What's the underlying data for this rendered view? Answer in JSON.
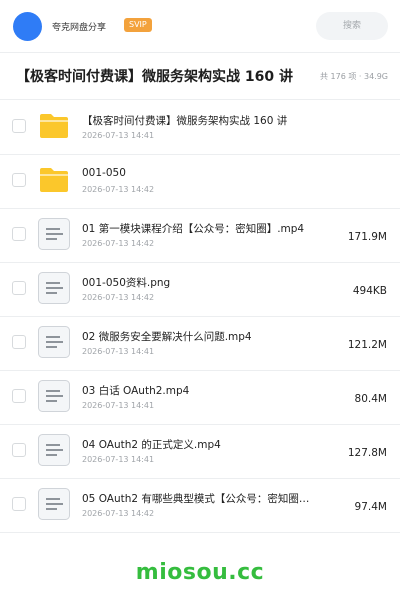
{
  "header": {
    "username": "夸克网盘分享",
    "badge": "SVIP",
    "search_label": "搜索",
    "avatar_color": "#2f7cf6"
  },
  "share": {
    "title": "【极客时间付费课】微服务架构实战 160 讲",
    "meta": "共 176 项 · 34.9G"
  },
  "files": [
    {
      "type": "folder",
      "icon": "folder-icon",
      "name": "【极客时间付费课】微服务架构实战 160 讲",
      "date": "2026-07-13 14:41",
      "size": ""
    },
    {
      "type": "folder",
      "icon": "folder-icon",
      "name": "001-050",
      "date": "2026-07-13 14:42",
      "size": ""
    },
    {
      "type": "file",
      "icon": "document-icon",
      "name": "01 第一模块课程介绍【公众号：密知圈】.mp4",
      "date": "2026-07-13 14:42",
      "size": "171.9M"
    },
    {
      "type": "file",
      "icon": "document-icon",
      "name": "001-050资料.png",
      "date": "2026-07-13 14:42",
      "size": "494KB"
    },
    {
      "type": "file",
      "icon": "document-icon",
      "name": "02 微服务安全要解决什么问题.mp4",
      "date": "2026-07-13 14:41",
      "size": "121.2M"
    },
    {
      "type": "file",
      "icon": "document-icon",
      "name": "03 白话 OAuth2.mp4",
      "date": "2026-07-13 14:41",
      "size": "80.4M"
    },
    {
      "type": "file",
      "icon": "document-icon",
      "name": "04 OAuth2 的正式定义.mp4",
      "date": "2026-07-13 14:41",
      "size": "127.8M"
    },
    {
      "type": "file",
      "icon": "document-icon",
      "name": "05 OAuth2 有哪些典型模式【公众号：密知圈…",
      "date": "2026-07-13 14:42",
      "size": "97.4M"
    }
  ],
  "watermark": "miosou.cc",
  "colors": {
    "folder": "#fbc72b",
    "accent_green": "#35bd3e",
    "badge": "#f3a23c"
  }
}
